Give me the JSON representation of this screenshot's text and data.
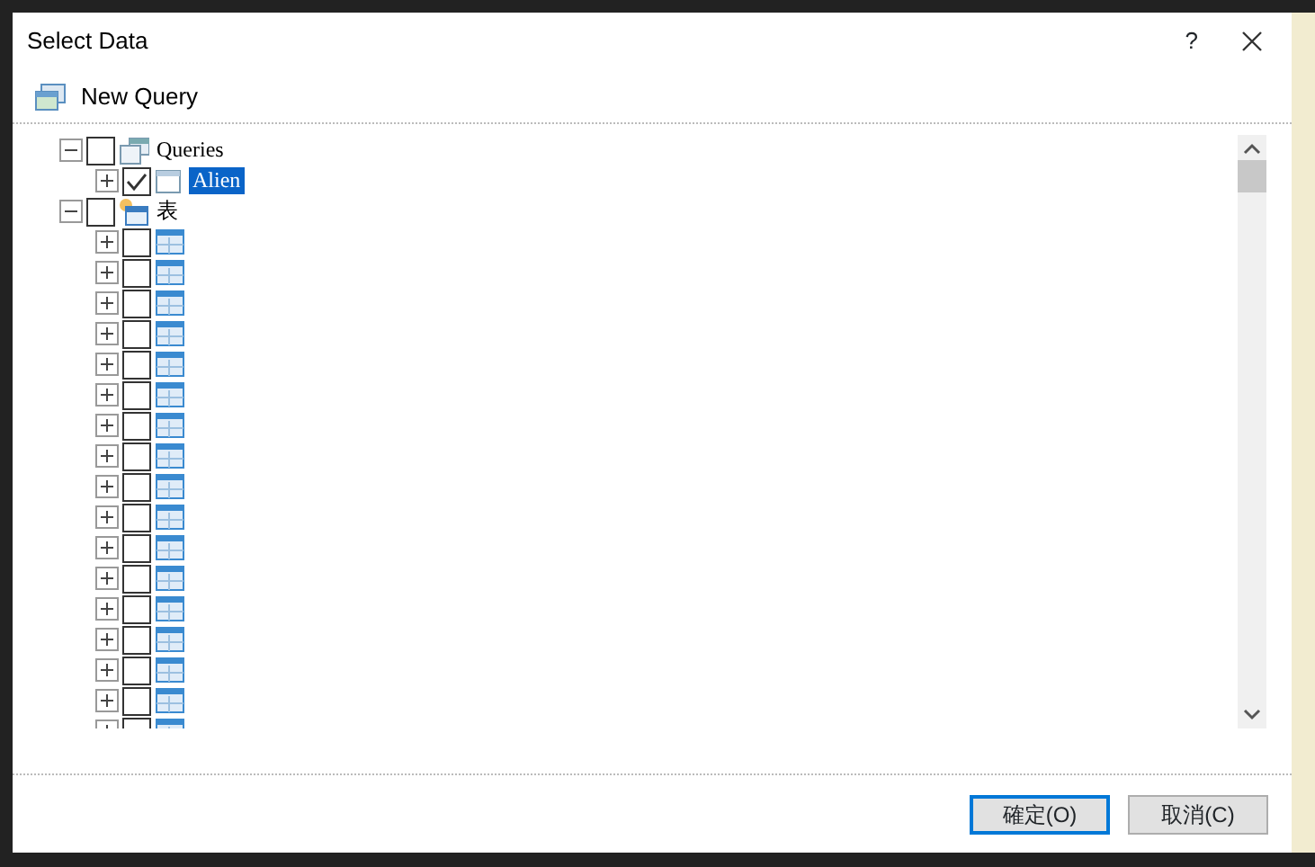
{
  "window": {
    "title": "Select Data",
    "help": "?"
  },
  "toolbar": {
    "label": "New Query"
  },
  "tree": [
    {
      "label": "Queries",
      "kind": "query-group",
      "checked": false,
      "expanded": true,
      "selected": false,
      "children": [
        {
          "label": "Alien",
          "kind": "query",
          "checked": true,
          "expanded": false,
          "selected": true
        }
      ]
    },
    {
      "label": "表",
      "kind": "table-group",
      "checked": false,
      "expanded": true,
      "selected": false,
      "children": [
        {
          "kind": "table",
          "checked": false,
          "expanded": false
        },
        {
          "kind": "table",
          "checked": false,
          "expanded": false
        },
        {
          "kind": "table",
          "checked": false,
          "expanded": false
        },
        {
          "kind": "table",
          "checked": false,
          "expanded": false
        },
        {
          "kind": "table",
          "checked": false,
          "expanded": false
        },
        {
          "kind": "table",
          "checked": false,
          "expanded": false
        },
        {
          "kind": "table",
          "checked": false,
          "expanded": false
        },
        {
          "kind": "table",
          "checked": false,
          "expanded": false
        },
        {
          "kind": "table",
          "checked": false,
          "expanded": false
        },
        {
          "kind": "table",
          "checked": false,
          "expanded": false
        },
        {
          "kind": "table",
          "checked": false,
          "expanded": false
        },
        {
          "kind": "table",
          "checked": false,
          "expanded": false
        },
        {
          "kind": "table",
          "checked": false,
          "expanded": false
        },
        {
          "kind": "table",
          "checked": false,
          "expanded": false
        },
        {
          "kind": "table",
          "checked": false,
          "expanded": false
        },
        {
          "kind": "table",
          "checked": false,
          "expanded": false
        },
        {
          "kind": "table",
          "checked": false,
          "expanded": false
        }
      ]
    }
  ],
  "buttons": [
    {
      "label": "確定(O)",
      "default": true
    },
    {
      "label": "取消(C)",
      "default": false
    }
  ]
}
